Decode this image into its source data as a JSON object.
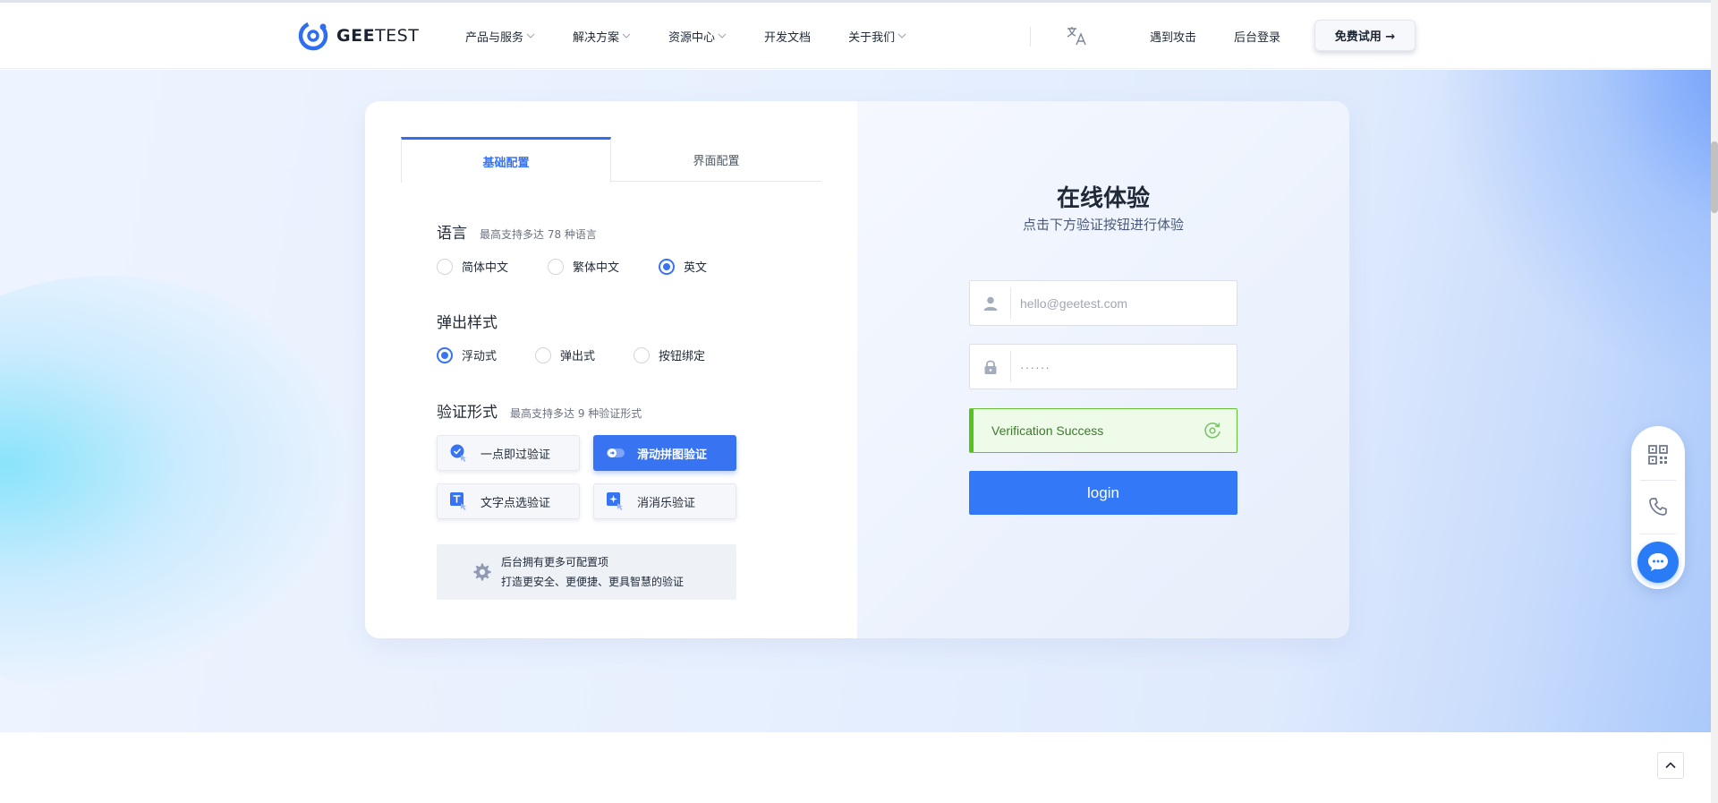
{
  "brand": {
    "name_bold": "GEE",
    "name_light": "TEST"
  },
  "nav": {
    "items": [
      {
        "label": "产品与服务",
        "has_dropdown": true
      },
      {
        "label": "解决方案",
        "has_dropdown": true
      },
      {
        "label": "资源中心",
        "has_dropdown": true
      },
      {
        "label": "开发文档",
        "has_dropdown": false
      },
      {
        "label": "关于我们",
        "has_dropdown": true
      }
    ],
    "language_icon": "translate-icon",
    "attack_link": "遇到攻击",
    "console_link": "后台登录",
    "trial_button": "免费试用 →"
  },
  "config": {
    "tabs": [
      {
        "label": "基础配置",
        "active": true
      },
      {
        "label": "界面配置",
        "active": false
      }
    ],
    "language": {
      "title": "语言",
      "subtitle": "最高支持多达 78 种语言",
      "options": [
        {
          "label": "简体中文",
          "checked": false
        },
        {
          "label": "繁体中文",
          "checked": false
        },
        {
          "label": "英文",
          "checked": true
        }
      ]
    },
    "popup": {
      "title": "弹出样式",
      "options": [
        {
          "label": "浮动式",
          "checked": true
        },
        {
          "label": "弹出式",
          "checked": false
        },
        {
          "label": "按钮绑定",
          "checked": false
        }
      ]
    },
    "verify": {
      "title": "验证形式",
      "subtitle": "最高支持多达 9 种验证形式",
      "options": [
        {
          "label": "一点即过验证",
          "active": false,
          "icon": "click-verify-icon"
        },
        {
          "label": "滑动拼图验证",
          "active": true,
          "icon": "slide-verify-icon"
        },
        {
          "label": "文字点选验证",
          "active": false,
          "icon": "text-select-icon"
        },
        {
          "label": "消消乐验证",
          "active": false,
          "icon": "match-verify-icon"
        }
      ]
    },
    "more": {
      "line1": "后台拥有更多可配置项",
      "line2": "打造更安全、更便捷、更具智慧的验证"
    }
  },
  "demo": {
    "title": "在线体验",
    "subtitle": "点击下方验证按钮进行体验",
    "email_placeholder": "hello@geetest.com",
    "password_value": "······",
    "success_text": "Verification Success",
    "login_button": "login"
  },
  "float_bar": {
    "items": [
      "qrcode-icon",
      "phone-icon",
      "chat-icon"
    ]
  },
  "colors": {
    "primary": "#3873f2",
    "success": "#52c41a",
    "success_bg": "#eefbe9"
  }
}
